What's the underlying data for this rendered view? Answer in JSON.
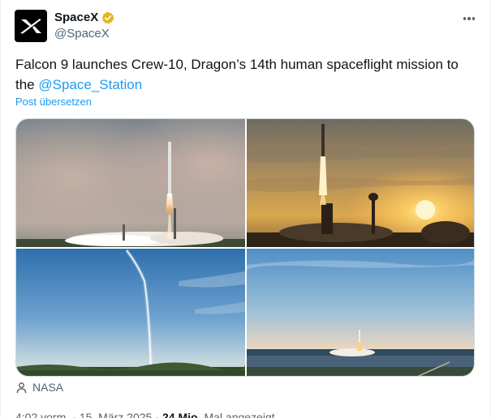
{
  "account": {
    "display_name": "SpaceX",
    "handle": "@SpaceX",
    "verified": true,
    "verified_color": "#e2b719",
    "avatar_icon": "spacex-x-logo"
  },
  "tweet": {
    "text_before_mention": "Falcon 9 launches Crew-10, Dragon’s 14th human spaceflight mission to the ",
    "mention": "@Space_Station",
    "translate_label": "Post übersetzen"
  },
  "media": {
    "photo_count": 4,
    "credit_icon": "person-icon",
    "credit": "NASA"
  },
  "meta": {
    "time": "4:02 vorm.",
    "separator1": "·",
    "date": "15. März 2025",
    "separator2": "·",
    "views_count": "24 Mio.",
    "views_label": "Mal angezeigt"
  },
  "colors": {
    "link": "#1d9bf0",
    "secondary_text": "#536471",
    "primary_text": "#0f1419"
  }
}
